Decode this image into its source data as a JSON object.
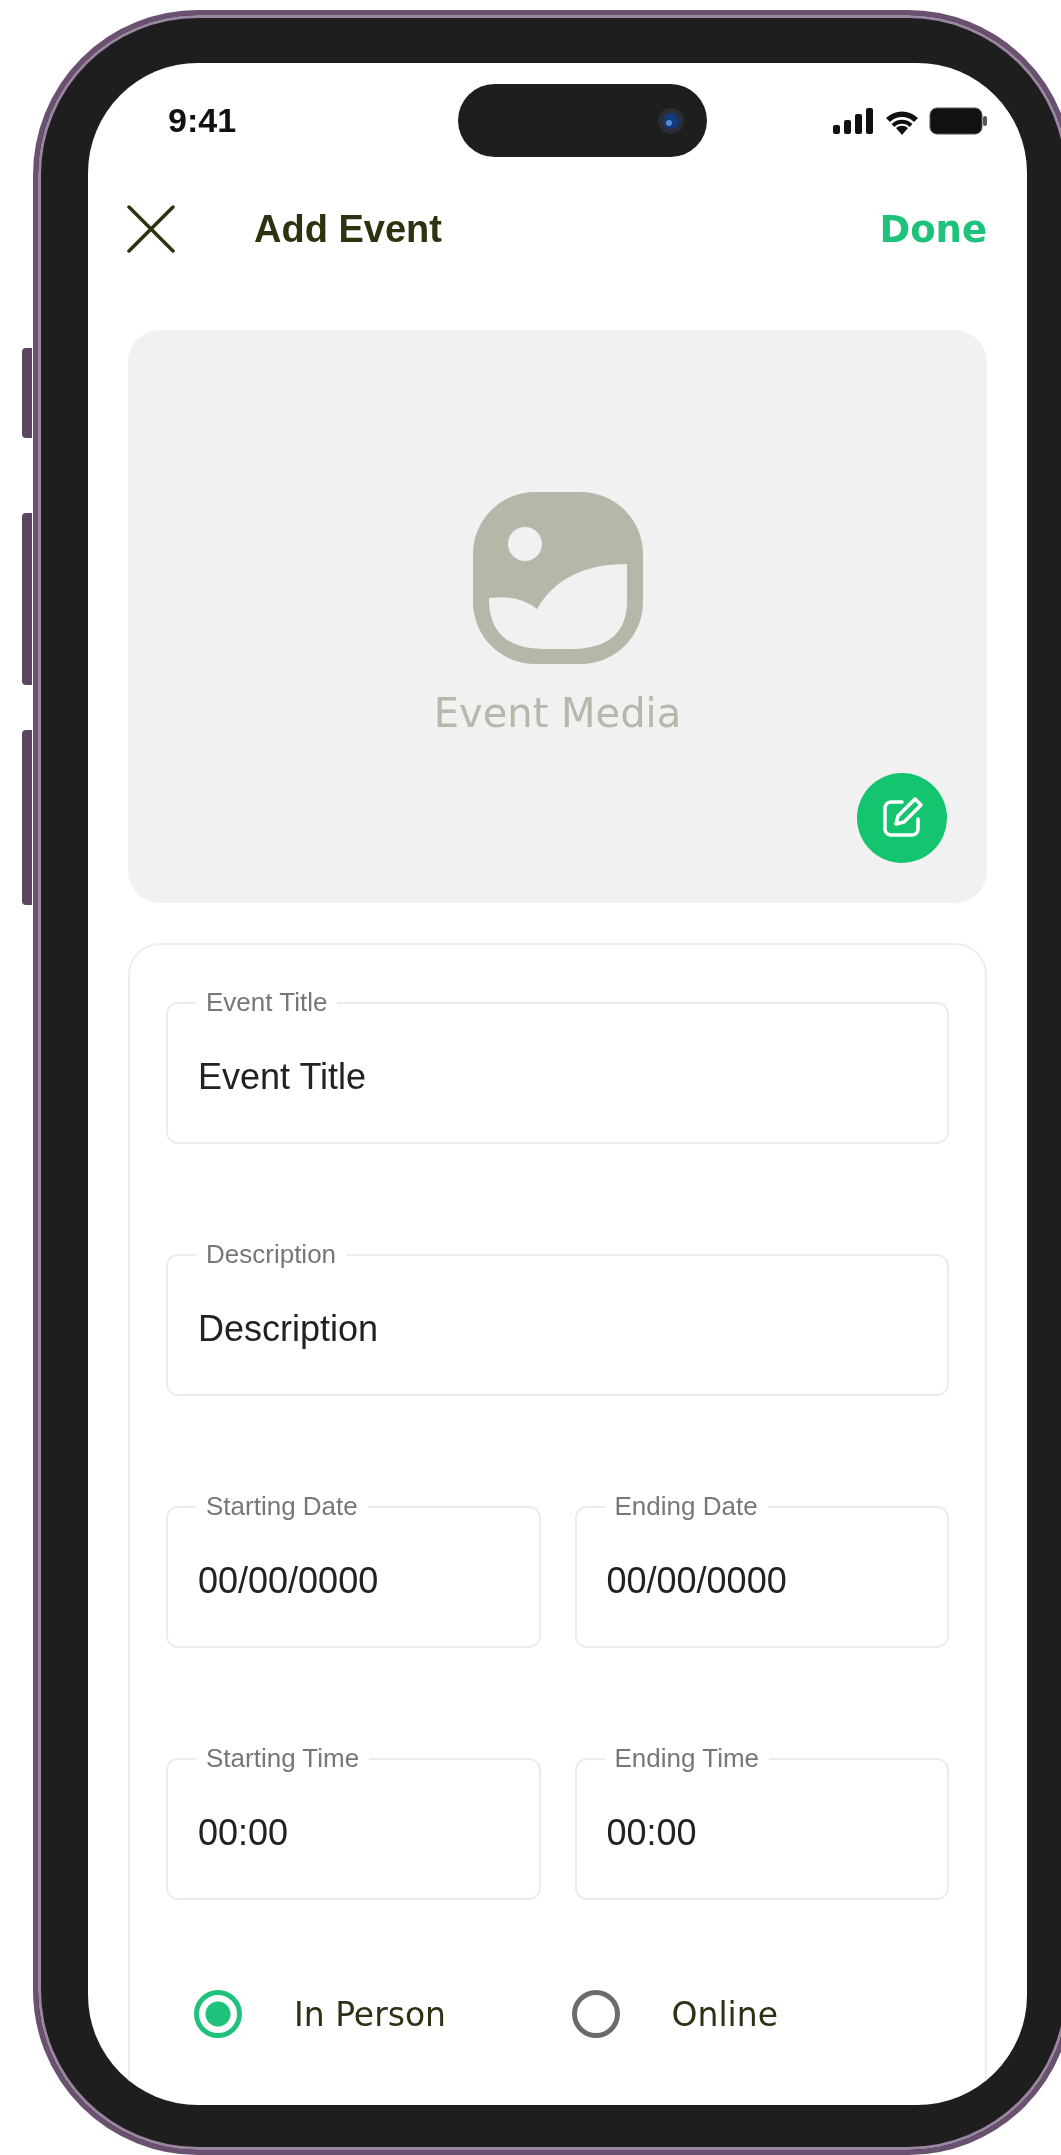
{
  "status_bar": {
    "time": "9:41"
  },
  "header": {
    "title": "Add Event",
    "action": "Done"
  },
  "media": {
    "label": "Event Media"
  },
  "form": {
    "rows": [
      [
        {
          "label": "Event Title",
          "placeholder": "Event Title"
        }
      ],
      [
        {
          "label": "Description",
          "placeholder": "Description"
        }
      ],
      [
        {
          "label": "Starting Date",
          "placeholder": "00/00/0000"
        },
        {
          "label": "Ending Date",
          "placeholder": "00/00/0000"
        }
      ],
      [
        {
          "label": "Starting Time",
          "placeholder": "00:00"
        },
        {
          "label": "Ending Time",
          "placeholder": "00:00"
        }
      ]
    ],
    "location_options": [
      {
        "label": "In Person",
        "selected": true
      },
      {
        "label": "Online",
        "selected": false
      }
    ]
  }
}
